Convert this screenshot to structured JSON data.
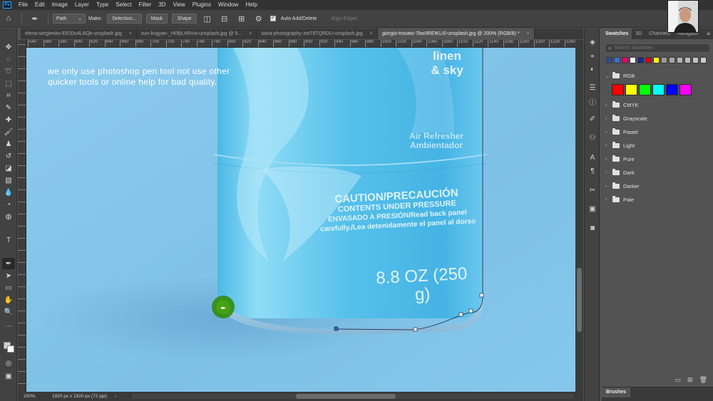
{
  "app": {
    "logo_text": "Ps"
  },
  "menu": [
    "File",
    "Edit",
    "Image",
    "Layer",
    "Type",
    "Select",
    "Filter",
    "3D",
    "View",
    "Plugins",
    "Window",
    "Help"
  ],
  "options": {
    "mode_value": "Path",
    "make_label": "Make:",
    "selection_btn": "Selection...",
    "mask_btn": "Mask",
    "shape_btn": "Shape",
    "auto_add_delete": "Auto Add/Delete",
    "align_edges": "Align Edges"
  },
  "tabs": [
    {
      "label": "elena-sergienko-EIfJDs4LAQk-unsplash.jpg",
      "active": false
    },
    {
      "label": "sun-lingyan-_H0fjILH5Vw-unsplash.jpg @ 5...",
      "active": false
    },
    {
      "label": "siora-photography-zot78TQRDU-unsplash.jpg",
      "active": false
    },
    {
      "label": "giorgio-trovato-7bw3REIKLI0-unsplash.jpg @ 200% (RGB/8) *",
      "active": true
    }
  ],
  "ruler_ticks": [
    "540",
    "560",
    "580",
    "600",
    "620",
    "640",
    "660",
    "680",
    "700",
    "720",
    "740",
    "760",
    "780",
    "800",
    "820",
    "840",
    "860",
    "880",
    "900",
    "920",
    "940",
    "960",
    "980",
    "1000",
    "1020",
    "1040",
    "1060",
    "1080",
    "1100",
    "1120",
    "1140",
    "1160",
    "1180",
    "1200",
    "1220",
    "1240"
  ],
  "canvas": {
    "annotation_line1": "we only use photoshop pen tool not use other",
    "annotation_line2": "quicker tools or online help for bad quality.",
    "bottle": {
      "brand_line1": "linen",
      "brand_line2": "& sky",
      "product_line1": "Air Refresher",
      "product_line2": "Ambientador",
      "caution_line1": "CAUTION/PRECAUCIÓN",
      "caution_line2": "CONTENTS UNDER PRESSURE",
      "caution_line3": "ENVASADO A PRESIÓN/Read back panel",
      "caution_line4": "carefully./Lea detenidamente el panel al dorso",
      "volume": "8.8 OZ (250 g)"
    }
  },
  "status": {
    "zoom": "200%",
    "doc_info": "1920 px x 1920 px (72 ppi)"
  },
  "panel": {
    "tabs": [
      "Swatches",
      "3D",
      "Channels",
      "Navigator"
    ],
    "search_placeholder": "Search Swatches",
    "recent_colors": [
      "#2f4a8f",
      "#3b6fd1",
      "#e4006b",
      "#ffffff",
      "#1b2a8a",
      "#d9001b",
      "#ffff00",
      "#9c9c9c",
      "#a8a8a8",
      "#b4b4b4",
      "#bdbdbd",
      "#c4c4c4",
      "#cccccc"
    ],
    "rgb_group": {
      "label": "RGB",
      "colors": [
        "#ff0000",
        "#ffff00",
        "#00ff00",
        "#00ffff",
        "#0000ff",
        "#ff00ff"
      ]
    },
    "groups": [
      "CMYK",
      "Grayscale",
      "Pastel",
      "Light",
      "Pure",
      "Dark",
      "Darker",
      "Pale"
    ]
  },
  "brushes_panel": {
    "label": "Brushes"
  }
}
